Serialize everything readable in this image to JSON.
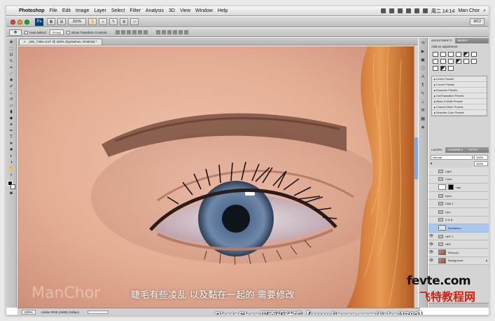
{
  "menubar": {
    "app_name": "Photoshop",
    "items": [
      "File",
      "Edit",
      "Image",
      "Layer",
      "Select",
      "Filter",
      "Analysis",
      "3D",
      "View",
      "Window",
      "Help"
    ],
    "clock": "周二 14:14",
    "user": "Man Chor"
  },
  "appbar": {
    "logo": "Ps",
    "zoom": "200%",
    "workspace": "MC2"
  },
  "options_bar": {
    "auto_select_label": "Auto-Select:",
    "auto_select_value": "Group",
    "show_transform_label": "Show Transform Controls"
  },
  "document": {
    "tab_title": "_MG_7465-4c1F @ 200% (Eyelashes, RGB/16) *",
    "watermark": "ManChor",
    "subtitle": "睫毛有些凌乱 以及黏在一起的 需要修改"
  },
  "status": {
    "zoom": "200%",
    "profile": "Adobe RGB (1998) (16bpc)"
  },
  "adjustments": {
    "tabs": [
      "ADJUSTMENTS",
      "MASKS"
    ],
    "title": "Add an adjustment",
    "presets": [
      "Levels Presets",
      "Curves Presets",
      "Exposure Presets",
      "Hue/Saturation Presets",
      "Black & White Presets",
      "Channel Mixer Presets",
      "Selective Color Presets"
    ]
  },
  "layers_panel": {
    "tabs": [
      "LAYERS",
      "CHANNELS",
      "PATHS"
    ],
    "blend_mode": "Normal",
    "opacity": "100%",
    "fill": "100%",
    "layers": [
      {
        "name": "Light",
        "type": "folder"
      },
      {
        "name": "Color",
        "type": "folder"
      },
      {
        "name": "Hair",
        "type": "mask"
      },
      {
        "name": "Eyes",
        "type": "folder"
      },
      {
        "name": "D&B 2",
        "type": "folder"
      },
      {
        "name": "Lips",
        "type": "folder"
      },
      {
        "name": "D & B",
        "type": "folder"
      },
      {
        "name": "Eyelashes",
        "type": "blank"
      },
      {
        "name": "HEP 2",
        "type": "folder"
      },
      {
        "name": "HEP",
        "type": "folder"
      },
      {
        "name": "Retouch",
        "type": "face"
      },
      {
        "name": "Background",
        "type": "face"
      }
    ]
  },
  "branding": {
    "site_en": "fevte.com",
    "site_cn": "飞特教程网",
    "forum": "PhotoShop平面设计吧【www.linecg.com/tieba/1783】"
  }
}
